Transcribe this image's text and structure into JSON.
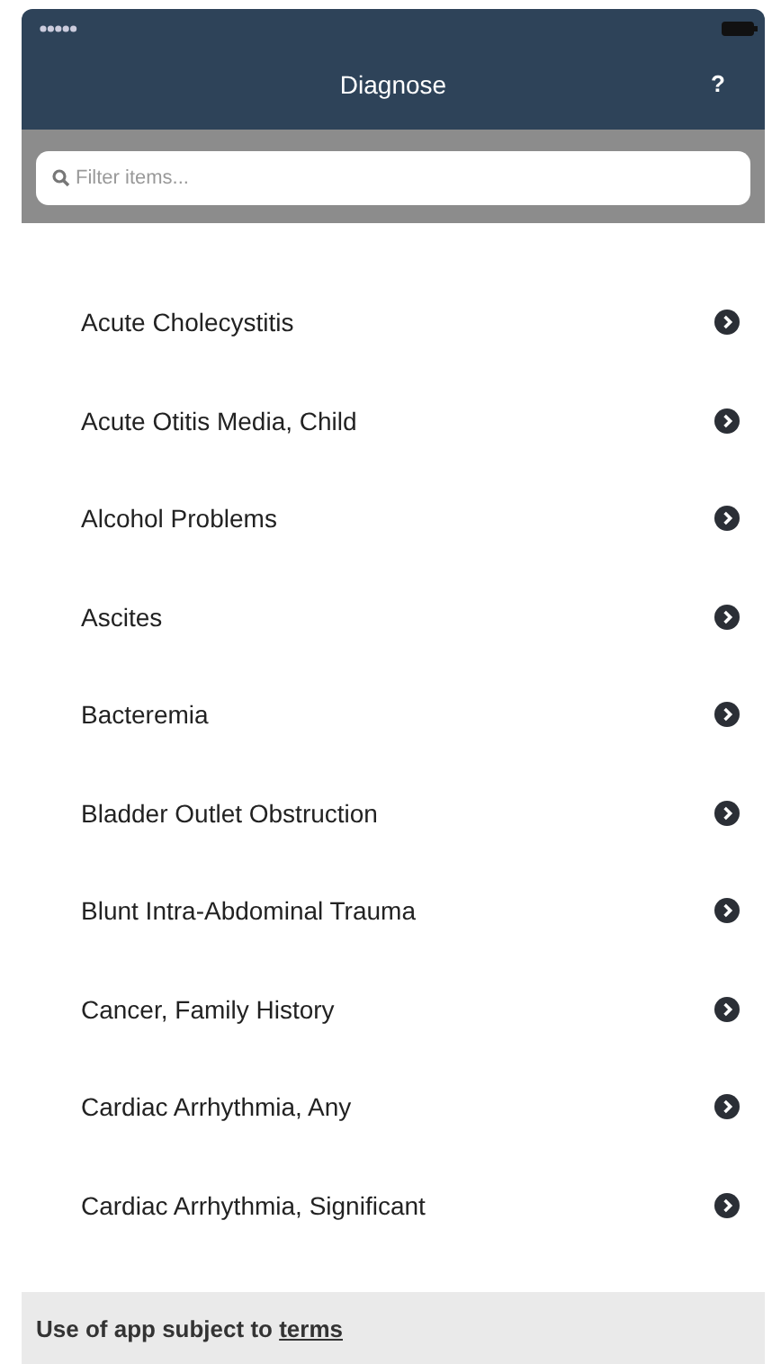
{
  "nav_bar": {
    "title": "Diagnose",
    "help_button": "?"
  },
  "search": {
    "placeholder": "Filter items..."
  },
  "items": [
    {
      "label": "Acute Cholecystitis"
    },
    {
      "label": "Acute Otitis Media, Child"
    },
    {
      "label": "Alcohol Problems"
    },
    {
      "label": "Ascites"
    },
    {
      "label": "Bacteremia"
    },
    {
      "label": "Bladder Outlet Obstruction"
    },
    {
      "label": "Blunt Intra-Abdominal Trauma"
    },
    {
      "label": "Cancer, Family History"
    },
    {
      "label": "Cardiac Arrhythmia, Any"
    },
    {
      "label": "Cardiac Arrhythmia, Significant"
    }
  ],
  "footer": {
    "text": "Use of app subject to",
    "link": "terms"
  }
}
